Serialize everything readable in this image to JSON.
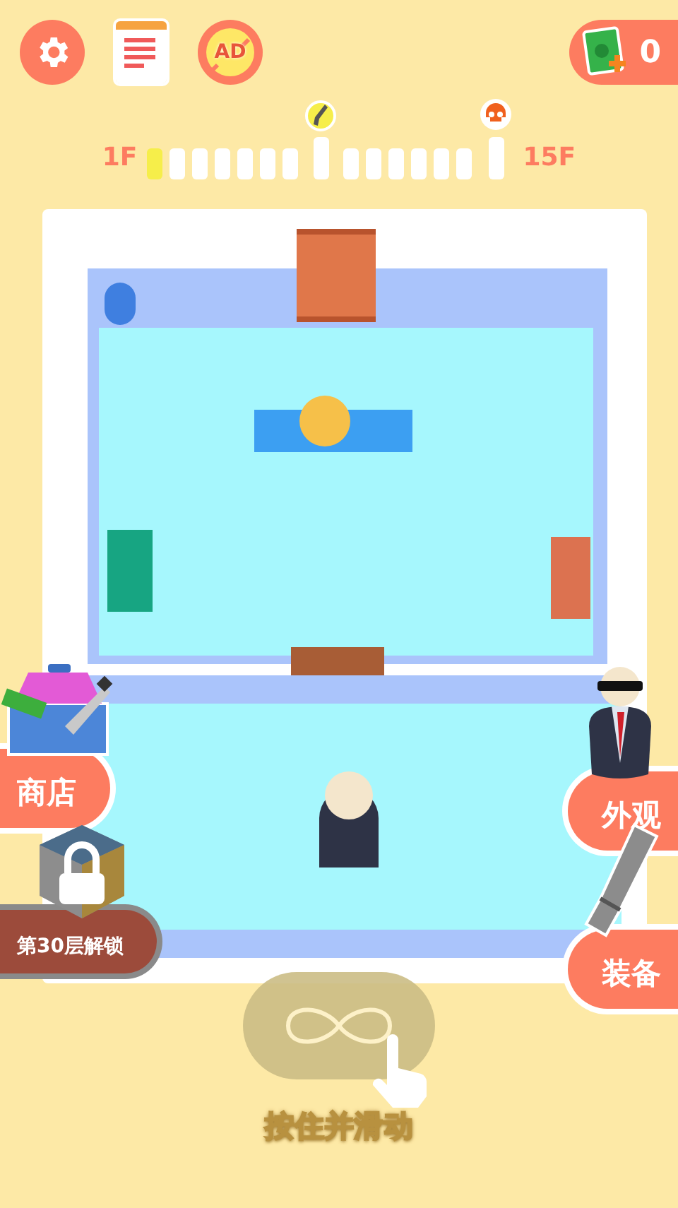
{
  "top_bar": {
    "no_ads_label": "AD",
    "cash": "0"
  },
  "progress": {
    "start_label": "1F",
    "end_label": "15F",
    "floors": [
      {
        "kind": "normal",
        "reached": true
      },
      {
        "kind": "normal",
        "reached": false
      },
      {
        "kind": "normal",
        "reached": false
      },
      {
        "kind": "normal",
        "reached": false
      },
      {
        "kind": "normal",
        "reached": false
      },
      {
        "kind": "normal",
        "reached": false
      },
      {
        "kind": "normal",
        "reached": false
      },
      {
        "kind": "weapon",
        "reached": false
      },
      {
        "kind": "normal",
        "reached": false
      },
      {
        "kind": "normal",
        "reached": false
      },
      {
        "kind": "normal",
        "reached": false
      },
      {
        "kind": "normal",
        "reached": false
      },
      {
        "kind": "normal",
        "reached": false
      },
      {
        "kind": "normal",
        "reached": false
      },
      {
        "kind": "boss",
        "reached": false
      }
    ]
  },
  "side_buttons": [
    {
      "kind": "shop",
      "label": "商店",
      "locked": false
    },
    {
      "kind": "skin",
      "label": "外观",
      "locked": false
    },
    {
      "kind": "mystery",
      "label": "第30层解锁",
      "locked": true
    },
    {
      "kind": "gear",
      "label": "装备",
      "locked": false
    }
  ],
  "hint": {
    "label": "按住并滑动"
  }
}
